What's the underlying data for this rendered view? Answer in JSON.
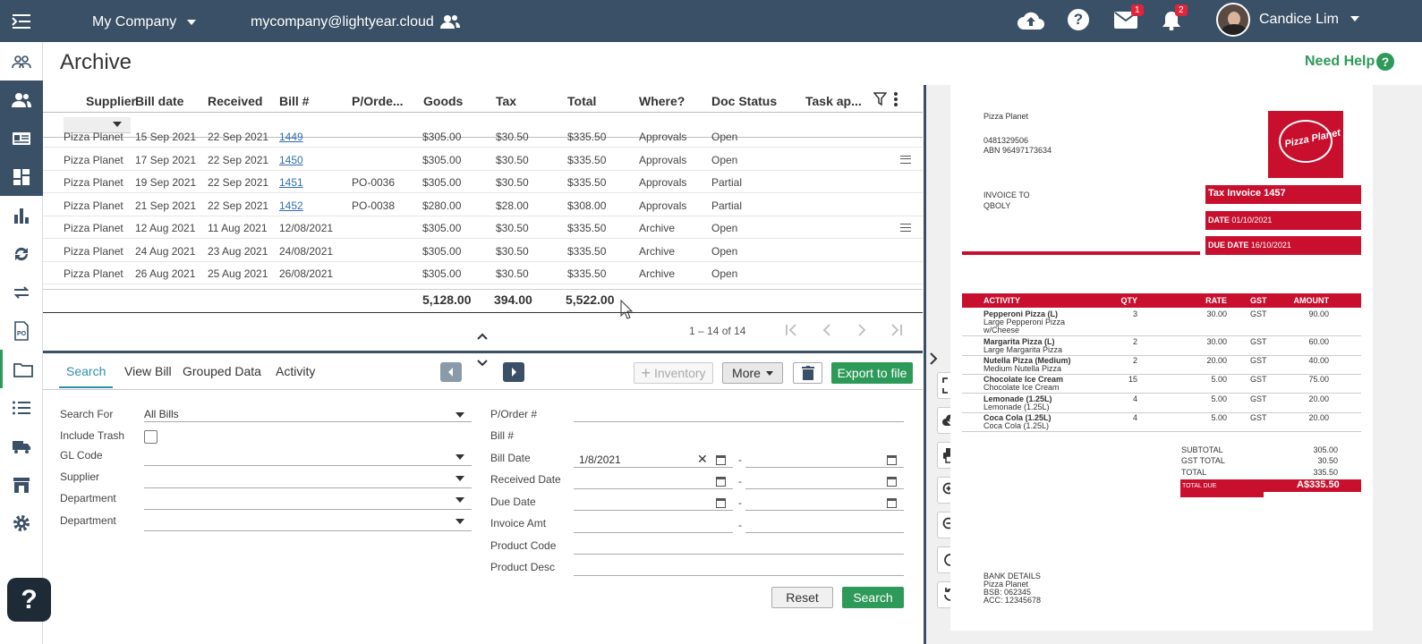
{
  "topbar": {
    "company": "My Company",
    "email": "mycompany@lightyear.cloud",
    "mail_badge": "1",
    "notif_badge": "2",
    "user_name": "Candice Lim"
  },
  "page": {
    "title": "Archive",
    "need_help": "Need Help",
    "help_q": "?"
  },
  "grid": {
    "headers": [
      "Supplier",
      "Bill date",
      "Received",
      "Bill #",
      "P/Orde...",
      "Goods",
      "Tax",
      "Total",
      "Where?",
      "Doc Status",
      "Task ap..."
    ],
    "rows": [
      [
        "Pizza Planet",
        "15 Sep 2021",
        "22 Sep 2021",
        "1449",
        "",
        "$305.00",
        "$30.50",
        "$335.50",
        "Approvals",
        "Open",
        ""
      ],
      [
        "Pizza Planet",
        "17 Sep 2021",
        "22 Sep 2021",
        "1450",
        "",
        "$305.00",
        "$30.50",
        "$335.50",
        "Approvals",
        "Open",
        "note"
      ],
      [
        "Pizza Planet",
        "19 Sep 2021",
        "22 Sep 2021",
        "1451",
        "PO-0036",
        "$305.00",
        "$30.50",
        "$335.50",
        "Approvals",
        "Partial",
        ""
      ],
      [
        "Pizza Planet",
        "21 Sep 2021",
        "22 Sep 2021",
        "1452",
        "PO-0038",
        "$280.00",
        "$28.00",
        "$308.00",
        "Approvals",
        "Partial",
        ""
      ],
      [
        "Pizza Planet",
        "12 Aug 2021",
        "11 Aug 2021",
        "12/08/2021",
        "",
        "$305.00",
        "$30.50",
        "$335.50",
        "Archive",
        "Open",
        "note"
      ],
      [
        "Pizza Planet",
        "24 Aug 2021",
        "23 Aug 2021",
        "24/08/2021",
        "",
        "$305.00",
        "$30.50",
        "$335.50",
        "Archive",
        "Open",
        ""
      ],
      [
        "Pizza Planet",
        "26 Aug 2021",
        "25 Aug 2021",
        "26/08/2021",
        "",
        "$305.00",
        "$30.50",
        "$335.50",
        "Archive",
        "Open",
        ""
      ]
    ],
    "totals": {
      "goods": "5,128.00",
      "tax": "394.00",
      "total": "5,522.00"
    },
    "pagination": "1 – 14 of 14"
  },
  "tabs": [
    "Search",
    "View Bill",
    "Grouped Data",
    "Activity"
  ],
  "toolbar": {
    "inventory": "Inventory",
    "more": "More",
    "export": "Export to file"
  },
  "search": {
    "left_labels": [
      "Search For",
      "Include Trash",
      "GL Code",
      "Supplier",
      "Department",
      "Department"
    ],
    "search_for_value": "All Bills",
    "right_labels": [
      "P/Order #",
      "Bill #",
      "Bill Date",
      "Received Date",
      "Due Date",
      "Invoice Amt",
      "Product Code",
      "Product Desc"
    ],
    "bill_date_from": "1/8/2021",
    "dash": "-",
    "reset": "Reset",
    "search": "Search"
  },
  "invoice": {
    "company": "Pizza Planet",
    "phone": "0481329506",
    "abn": "ABN 96497173634",
    "invoice_to_label": "INVOICE TO",
    "invoice_to": "QBOLY",
    "tax_invoice_label": "Tax Invoice",
    "tax_invoice_no": "1457",
    "date_label": "DATE",
    "date": "01/10/2021",
    "due_label": "DUE DATE",
    "due": "16/10/2021",
    "logo_text": "Pizza Planet",
    "cols": [
      "ACTIVITY",
      "QTY",
      "RATE",
      "GST",
      "AMOUNT"
    ],
    "items": [
      {
        "name": "Pepperoni Pizza (L)",
        "desc": "Large Pepperoni Pizza",
        "desc2": "w/Cheese",
        "qty": "3",
        "rate": "30.00",
        "gst": "GST",
        "amount": "90.00"
      },
      {
        "name": "Margarita Pizza (L)",
        "desc": "Large Margarita Pizza",
        "desc2": "",
        "qty": "2",
        "rate": "30.00",
        "gst": "GST",
        "amount": "60.00"
      },
      {
        "name": "Nutella Pizza (Medium)",
        "desc": "Medium Nutella Pizza",
        "desc2": "",
        "qty": "2",
        "rate": "20.00",
        "gst": "GST",
        "amount": "40.00"
      },
      {
        "name": "Chocolate Ice Cream",
        "desc": "Chocolate Ice Cream",
        "desc2": "",
        "qty": "15",
        "rate": "5.00",
        "gst": "GST",
        "amount": "75.00"
      },
      {
        "name": "Lemonade (1.25L)",
        "desc": "Lemonade (1.25L)",
        "desc2": "",
        "qty": "4",
        "rate": "5.00",
        "gst": "GST",
        "amount": "20.00"
      },
      {
        "name": "Coca Cola (1.25L)",
        "desc": "Coca Cola (1.25L)",
        "desc2": "",
        "qty": "4",
        "rate": "5.00",
        "gst": "GST",
        "amount": "20.00"
      }
    ],
    "subtotal_label": "SUBTOTAL",
    "subtotal": "305.00",
    "gst_total_label": "GST TOTAL",
    "gst_total": "30.50",
    "total_label": "TOTAL",
    "total": "335.50",
    "total_due_label": "TOTAL DUE",
    "total_due": "A$335.50",
    "bank_label": "BANK DETAILS",
    "bank_name": "Pizza Planet",
    "bsb": "BSB: 062345",
    "acc": "ACC: 12345678"
  },
  "colors": {
    "nav": "#3a5066",
    "accent_green": "#2e9a5a",
    "invoice_red": "#c8102e",
    "link": "#2f6db3"
  }
}
